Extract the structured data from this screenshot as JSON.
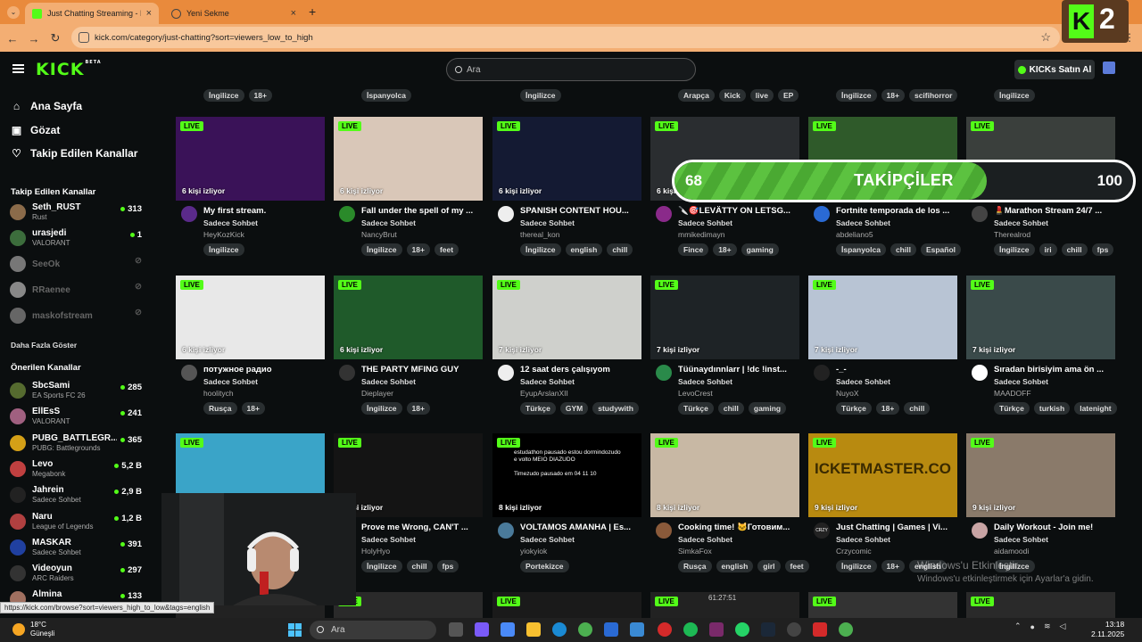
{
  "browser": {
    "tabs": [
      {
        "title": "Just Chatting Streaming - Live S",
        "close": "×"
      },
      {
        "title": "Yeni Sekme",
        "close": "×"
      }
    ],
    "new_tab": "+",
    "url": "kick.com/category/just-chatting?sort=viewers_low_to_high",
    "status_url": "https://kick.com/browse?sort=viewers_high_to_low&tags=english"
  },
  "header": {
    "logo": "KICK",
    "logo_beta": "BETA",
    "search_placeholder": "Ara",
    "buy_kicks": "KICKs Satın Al"
  },
  "sidebar": {
    "nav": [
      {
        "label": "Ana Sayfa",
        "icon": "home-icon"
      },
      {
        "label": "Gözat",
        "icon": "browse-icon"
      },
      {
        "label": "Takip Edilen Kanallar",
        "icon": "heart-icon"
      }
    ],
    "followed_heading": "Takip Edilen Kanallar",
    "followed": [
      {
        "name": "Seth_RUST",
        "category": "Rust",
        "viewers": "313",
        "online": true,
        "color": "#8b6b4a"
      },
      {
        "name": "urasjedi",
        "category": "VALORANT",
        "viewers": "1",
        "online": true,
        "color": "#3c6d3c"
      },
      {
        "name": "SeeOk",
        "online": false,
        "color": "#777"
      },
      {
        "name": "RRaenee",
        "online": false,
        "color": "#888"
      },
      {
        "name": "maskofstream",
        "online": false,
        "color": "#666"
      }
    ],
    "show_more": "Daha Fazla Göster",
    "recommended_heading": "Önerilen Kanallar",
    "recommended": [
      {
        "name": "SbcSami",
        "category": "EA Sports FC 26",
        "viewers": "285",
        "color": "#556b2f"
      },
      {
        "name": "EllEsS",
        "category": "VALORANT",
        "viewers": "241",
        "color": "#a06080"
      },
      {
        "name": "PUBG_BATTLEGR...",
        "category": "PUBG: Battlegrounds",
        "viewers": "365",
        "color": "#d4a017"
      },
      {
        "name": "Levo",
        "category": "Megabonk",
        "viewers": "5,2 B",
        "color": "#c04040"
      },
      {
        "name": "Jahrein",
        "category": "Sadece Sohbet",
        "viewers": "2,9 B",
        "color": "#222"
      },
      {
        "name": "Naru",
        "category": "League of Legends",
        "viewers": "1,2 B",
        "color": "#b04040"
      },
      {
        "name": "MASKAR",
        "category": "Sadece Sohbet",
        "viewers": "391",
        "color": "#2040a0"
      },
      {
        "name": "Videoyun",
        "category": "ARC Raiders",
        "viewers": "297",
        "color": "#333"
      },
      {
        "name": "Almina",
        "category": "",
        "viewers": "133",
        "color": "#a07060"
      }
    ]
  },
  "top_tag_rows": [
    [
      "İngilizce",
      "18+"
    ],
    [
      "İspanyolca"
    ],
    [
      "İngilizce"
    ],
    [
      "Arapça",
      "Kick",
      "live",
      "EP"
    ],
    [
      "İngilizce",
      "18+",
      "scifihorror"
    ],
    [
      "İngilizce"
    ]
  ],
  "cards": [
    {
      "live": "LIVE",
      "viewers": "6 kişi izliyor",
      "title": "My first stream.",
      "category": "Sadece Sohbet",
      "channel": "HeyKozKick",
      "tags": [
        "İngilizce"
      ],
      "bg": "#3a1258",
      "av": "#5a2a8a"
    },
    {
      "live": "LIVE",
      "viewers": "6 kişi izliyor",
      "title": "Fall under the spell of my ...",
      "category": "Sadece Sohbet",
      "channel": "NancyBrut",
      "tags": [
        "İngilizce",
        "18+",
        "feet"
      ],
      "bg": "#d9c7b8",
      "av": "#2a8a2a"
    },
    {
      "live": "LIVE",
      "viewers": "6 kişi izliyor",
      "title": "SPANISH CONTENT HOU...",
      "category": "Sadece Sohbet",
      "channel": "thereal_kon",
      "tags": [
        "İngilizce",
        "english",
        "chill"
      ],
      "bg": "#141a33",
      "av": "#eee"
    },
    {
      "live": "LIVE",
      "viewers": "6 kişi izliyor",
      "title": "🔪🎯LEVÄTTY ON LETSG...",
      "category": "Sadece Sohbet",
      "channel": "mmikedimayn",
      "tags": [
        "Fince",
        "18+",
        "gaming"
      ],
      "bg": "#2a2d30",
      "av": "#8a2a8a"
    },
    {
      "live": "LIVE",
      "viewers": "6 kişi izliyor",
      "title": "Fortnite temporada de los ...",
      "category": "Sadece Sohbet",
      "channel": "abdeliano5",
      "tags": [
        "İspanyolca",
        "chill",
        "Español"
      ],
      "bg": "#2f5a2a",
      "av": "#2a6ad4"
    },
    {
      "live": "LIVE",
      "viewers": "6 kişi izliyor",
      "title": "💄Marathon Stream 24/7 ...",
      "category": "Sadece Sohbet",
      "channel": "Therealrod",
      "tags": [
        "İngilizce",
        "iri",
        "chill",
        "fps"
      ],
      "bg": "#3a3f3c",
      "av": "#444"
    },
    {
      "live": "LIVE",
      "viewers": "6 kişi izliyor",
      "title": "потужное радио",
      "category": "Sadece Sohbet",
      "channel": "hoolitych",
      "tags": [
        "Rusça",
        "18+"
      ],
      "bg": "#e8e8e8",
      "av": "#555"
    },
    {
      "live": "LIVE",
      "viewers": "6 kişi izliyor",
      "title": "THE PARTY MFING GUY",
      "category": "Sadece Sohbet",
      "channel": "Dieplayer",
      "tags": [
        "İngilizce",
        "18+"
      ],
      "bg": "#1f5a2a",
      "av": "#333"
    },
    {
      "live": "LIVE",
      "viewers": "7 kişi izliyor",
      "title": "12 saat ders çalışıyom",
      "category": "Sadece Sohbet",
      "channel": "EyupArslanXII",
      "tags": [
        "Türkçe",
        "GYM",
        "studywith"
      ],
      "bg": "#cfd0cc",
      "av": "#eee"
    },
    {
      "live": "LIVE",
      "viewers": "7 kişi izliyor",
      "title": "Tüünaydınnlarr | !dc !inst...",
      "category": "Sadece Sohbet",
      "channel": "LevoCrest",
      "tags": [
        "Türkçe",
        "chill",
        "gaming"
      ],
      "bg": "#1e2326",
      "av": "#2a8a4a"
    },
    {
      "live": "LIVE",
      "viewers": "7 kişi izliyor",
      "title": "-_-",
      "category": "Sadece Sohbet",
      "channel": "NuyoX",
      "tags": [
        "Türkçe",
        "18+",
        "chill"
      ],
      "bg": "#b8c4d4",
      "av": "#222"
    },
    {
      "live": "LIVE",
      "viewers": "7 kişi izliyor",
      "title": "Sıradan birisiyim ama ön ...",
      "category": "Sadece Sohbet",
      "channel": "MAADOFF",
      "tags": [
        "Türkçe",
        "turkish",
        "latenight"
      ],
      "bg": "#3a4a4a",
      "av": "#fff"
    },
    {
      "live": "LIVE",
      "viewers": "",
      "title": "",
      "category": "",
      "channel": "",
      "tags": [],
      "bg": "#3aa4c8",
      "av": "#333"
    },
    {
      "live": "LIVE",
      "viewers": "8 kişi izliyor",
      "title": "Prove me Wrong, CAN'T ...",
      "category": "Sadece Sohbet",
      "channel": "HolyHyo",
      "tags": [
        "İngilizce",
        "chill",
        "fps"
      ],
      "bg": "#141414",
      "av": "#555"
    },
    {
      "live": "LIVE",
      "viewers": "8 kişi izliyor",
      "title": "VOLTAMOS AMANHA | Es...",
      "category": "Sadece Sohbet",
      "channel": "yiokyiok",
      "tags": [
        "Portekizce"
      ],
      "bg": "#000",
      "av": "#4a7a9a",
      "note1": "estudathon pausado estou dormindozudo e volto MEIO DIAZUDO",
      "note2": "Timezudo pausado em 04 11 10"
    },
    {
      "live": "LIVE",
      "viewers": "8 kişi izliyor",
      "title": "Cooking time! 🐱Готовим...",
      "category": "Sadece Sohbet",
      "channel": "SimkaFox",
      "tags": [
        "Rusça",
        "english",
        "girl",
        "feet"
      ],
      "bg": "#c8b8a4",
      "av": "#8a5a3a"
    },
    {
      "live": "LIVE",
      "viewers": "9 kişi izliyor",
      "title": "Just Chatting | Games | Vi...",
      "category": "Sadece Sohbet",
      "channel": "Crzycomic",
      "tags": [
        "İngilizce",
        "18+",
        "english"
      ],
      "bg": "#b88a10",
      "av": "#222",
      "avtext": "CRZY",
      "banner": "ICKETMASTER.CO"
    },
    {
      "live": "LIVE",
      "viewers": "9 kişi izliyor",
      "title": "Daily Workout - Join me!",
      "category": "Sadece Sohbet",
      "channel": "aidamoodi",
      "tags": [
        "İngilizce"
      ],
      "bg": "#8a7a6a",
      "av": "#c8a4a4"
    }
  ],
  "bottom_cards": [
    {
      "live": "LIVE",
      "bg": "#222"
    },
    {
      "live": "LIVE",
      "bg": "#2a2a2a"
    },
    {
      "live": "LIVE",
      "bg": "#1a1a1a"
    },
    {
      "live": "LIVE",
      "bg": "#222",
      "timer": "61:27:51"
    },
    {
      "live": "LIVE",
      "bg": "#333"
    },
    {
      "live": "LIVE",
      "bg": "#2a2a2a"
    }
  ],
  "overlay": {
    "current": "68",
    "label": "TAKİPÇİLER",
    "goal": "100",
    "progress": 0.68,
    "badge_letter": "K",
    "badge_number": "2"
  },
  "windows_activation": {
    "title": "Windows'u Etkinleştir",
    "subtitle": "Windows'u etkinleştirmek için Ayarlar'a gidin."
  },
  "taskbar": {
    "temp": "18°C",
    "weather": "Güneşli",
    "search": "Ara",
    "time": "13:18",
    "date": "2.11.2025",
    "badge": "3"
  }
}
